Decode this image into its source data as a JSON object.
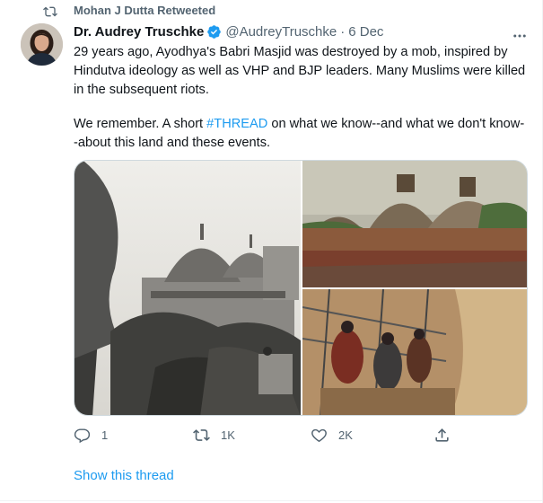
{
  "retweet": {
    "label": "Mohan J Dutta Retweeted",
    "icon": "retweet-icon"
  },
  "author": {
    "display_name": "Dr. Audrey Truschke",
    "handle": "@AudreyTruschke",
    "separator": "·",
    "date": "6 Dec",
    "verified_icon": "verified-badge-icon"
  },
  "tweet": {
    "paragraph_1": "29 years ago, Ayodhya's Babri Masjid was destroyed by a mob, inspired by Hindutva ideology as well as VHP and BJP leaders. Many Muslims were killed in the subsequent riots.",
    "paragraph_2_before": "We remember. A short ",
    "hashtag": "#THREAD",
    "paragraph_2_after": " on what we know--and what we don't know--about this land and these events."
  },
  "media": {
    "images": [
      {
        "name": "babri-masjid-historic-photo",
        "icon": "photo"
      },
      {
        "name": "crowd-on-domes-photo",
        "icon": "photo"
      },
      {
        "name": "demolition-photo",
        "icon": "photo"
      }
    ]
  },
  "actions": {
    "reply": {
      "icon": "reply-icon",
      "count": "1"
    },
    "retweet": {
      "icon": "retweet-icon",
      "count": "1K"
    },
    "like": {
      "icon": "heart-icon",
      "count": "2K"
    },
    "share": {
      "icon": "share-icon"
    }
  },
  "show_thread": "Show this thread",
  "colors": {
    "accent": "#1d9bf0",
    "secondary_text": "#536471",
    "primary_text": "#0f1419",
    "border": "#cfd9de"
  }
}
